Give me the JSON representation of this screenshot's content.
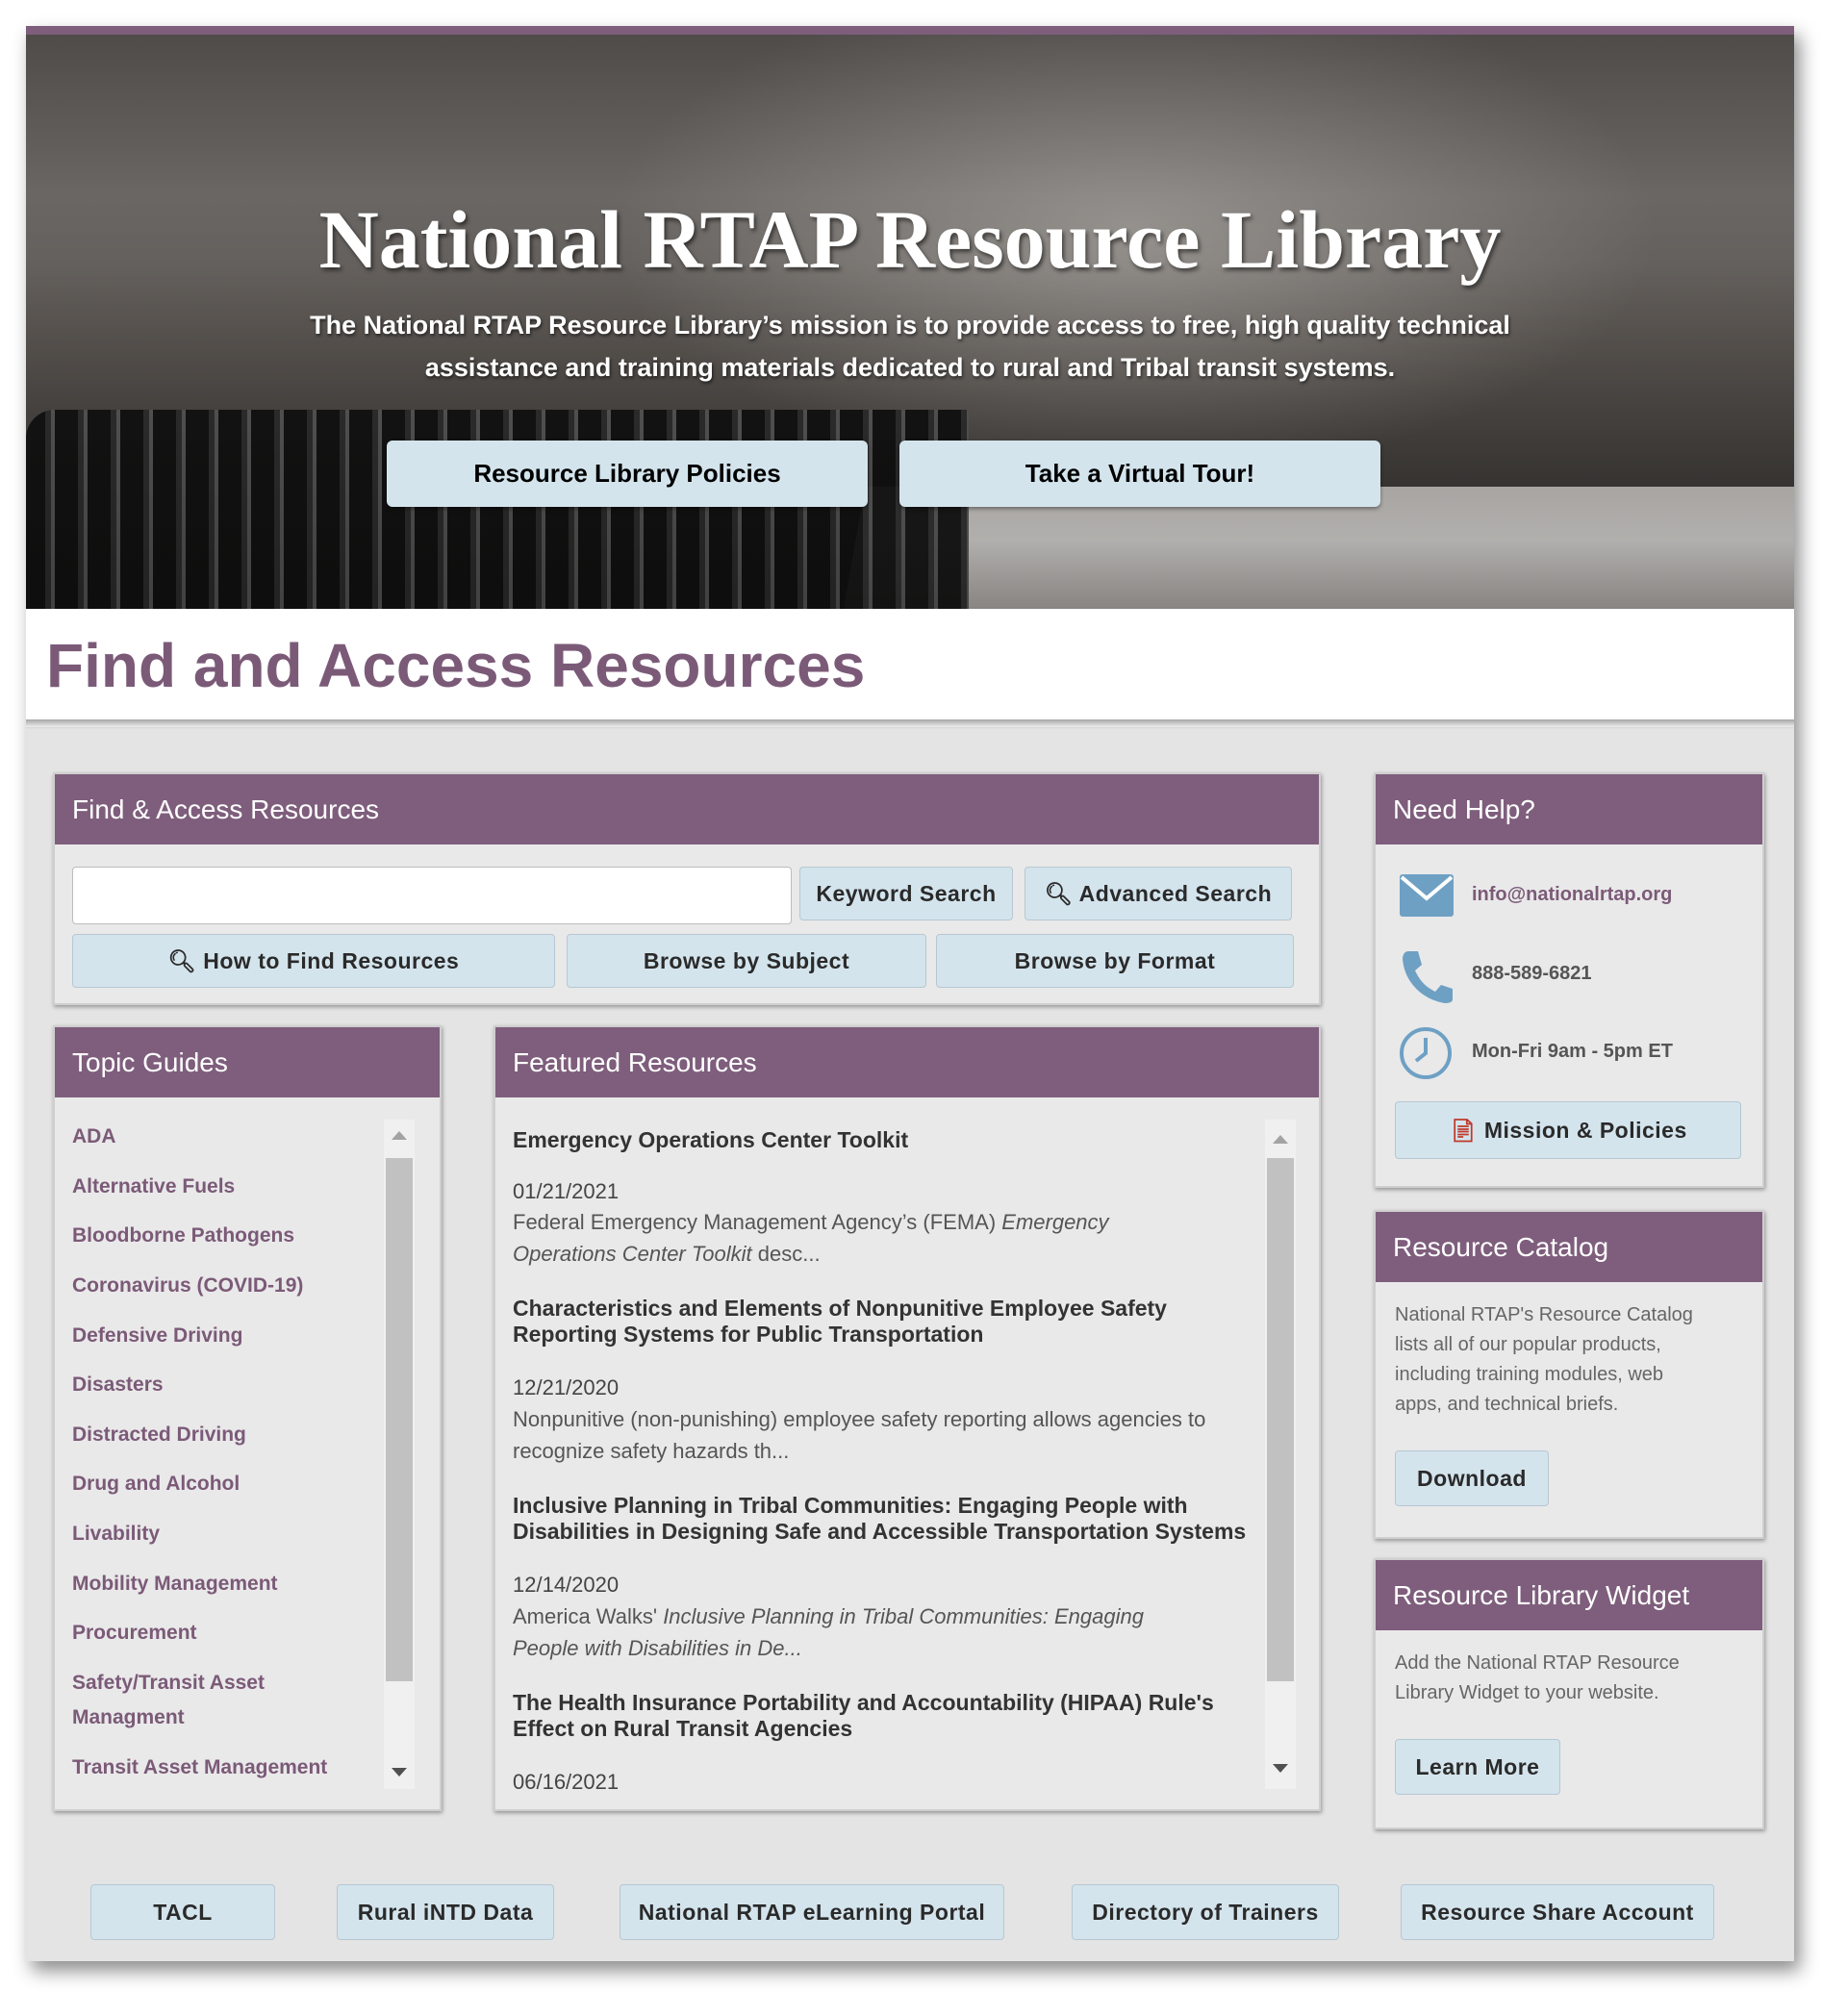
{
  "hero": {
    "title": "National RTAP Resource Library",
    "mission": "The National RTAP Resource Library’s mission is to provide access to free, high quality technical assistance and training materials dedicated to rural and Tribal transit systems.",
    "buttons": [
      "Resource Library Policies",
      "Take a Virtual Tour!"
    ]
  },
  "section_title": "Find and Access Resources",
  "find_panel": {
    "header": "Find & Access Resources",
    "search_value": "",
    "keyword_search": "Keyword Search",
    "advanced_search": "Advanced Search",
    "how_to_find": "How to Find Resources",
    "browse_subject": "Browse by Subject",
    "browse_format": "Browse by Format"
  },
  "topic_guides": {
    "header": "Topic Guides",
    "items": [
      "ADA",
      "Alternative Fuels",
      "Bloodborne Pathogens",
      "Coronavirus (COVID-19)",
      "Defensive Driving",
      "Disasters",
      "Distracted Driving",
      "Drug and Alcohol",
      "Livability",
      "Mobility Management",
      "Procurement",
      "Safety/Transit Asset",
      "Managment",
      "Transit Asset Management"
    ]
  },
  "featured": {
    "header": "Featured Resources",
    "items": [
      {
        "title": "Emergency Operations Center Toolkit",
        "date": "01/21/2021",
        "desc_1": "Federal Emergency Management Agency’s (FEMA) ",
        "desc_em_1": "Emergency",
        "desc_em_2": "Operations Center Toolkit",
        "desc_2": " desc..."
      },
      {
        "title_1": "Characteristics and Elements of Nonpunitive Employee Safety",
        "title_2": "Reporting Systems for Public Transportation",
        "date": "12/21/2020",
        "desc_line_1": "Nonpunitive (non-punishing) employee safety reporting allows agencies to",
        "desc_line_2": "recognize safety hazards th..."
      },
      {
        "title_1": "Inclusive Planning in Tribal Communities: Engaging People with",
        "title_2": "Disabilities in Designing Safe and Accessible Transportation Systems",
        "date": "12/14/2020",
        "desc_1": "America Walks' ",
        "desc_em_1": "Inclusive Planning in Tribal Communities: Engaging",
        "desc_em_2": "People with Disabilities in De..."
      },
      {
        "title_1": "The Health Insurance Portability and Accountability (HIPAA) Rule's",
        "title_2": "Effect on Rural Transit Agencies",
        "date": "06/16/2021"
      }
    ]
  },
  "help": {
    "header": "Need Help?",
    "email": "info@nationalrtap.org",
    "phone": "888-589-6821",
    "hours": "Mon-Fri 9am - 5pm ET",
    "mission_button": "Mission & Policies"
  },
  "catalog": {
    "header": "Resource Catalog",
    "lines": [
      "National RTAP's Resource Catalog",
      "lists all of our popular products,",
      "including training modules, web",
      "apps, and technical briefs."
    ],
    "button": "Download"
  },
  "widget": {
    "header": "Resource Library Widget",
    "lines": [
      "Add the National RTAP Resource",
      "Library Widget to your website."
    ],
    "button": "Learn More"
  },
  "footer_buttons": [
    "TACL",
    "Rural iNTD Data",
    "National RTAP eLearning Portal",
    "Directory of Trainers",
    "Resource Share Account"
  ],
  "colors": {
    "accent": "#7e5e7c",
    "button": "#d4e4ed",
    "link": "#7b5a78",
    "icon": "#6ea0c4"
  }
}
